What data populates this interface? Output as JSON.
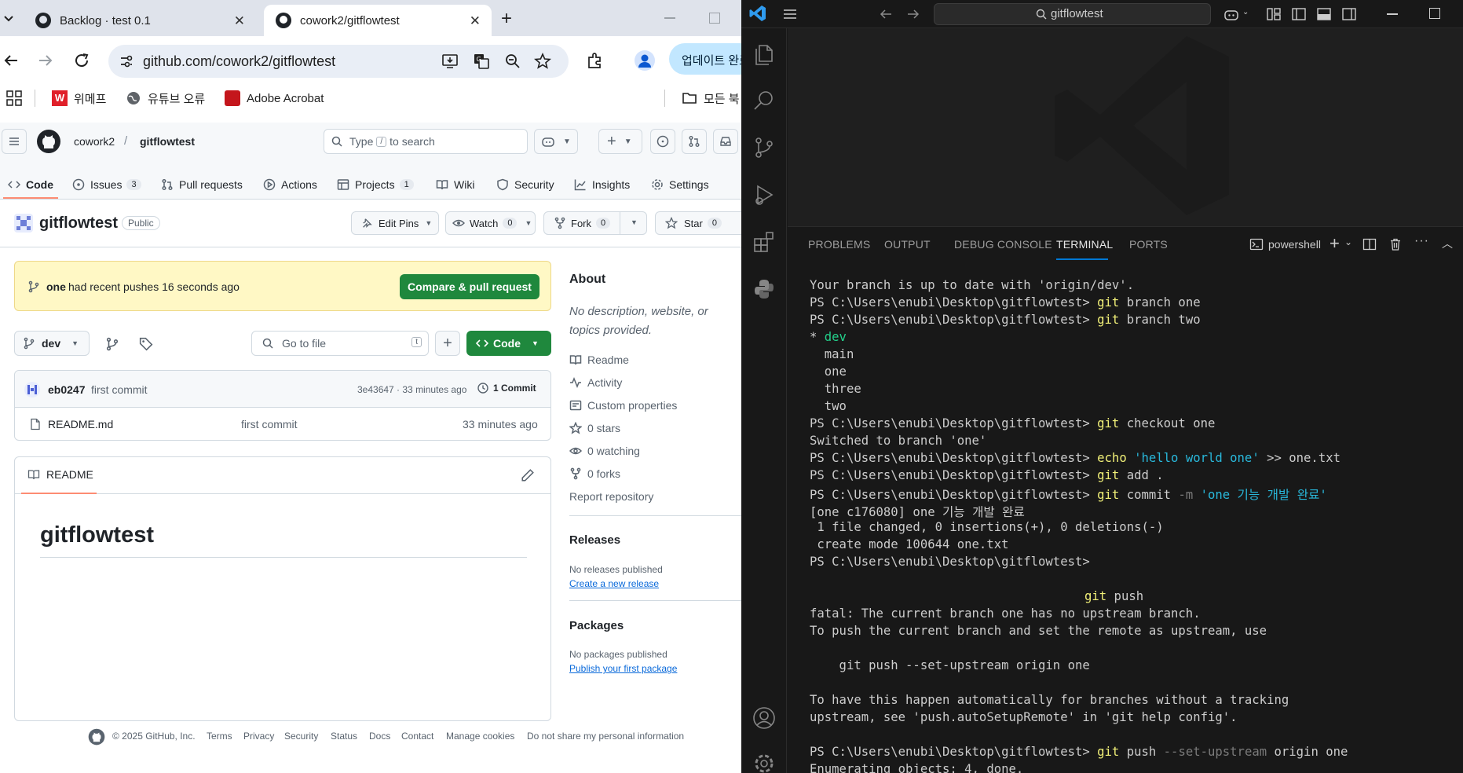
{
  "browser": {
    "tabs": [
      {
        "title": "Backlog · test 0.1",
        "active": false
      },
      {
        "title": "cowork2/gitflowtest",
        "active": true
      }
    ],
    "url": "github.com/cowork2/gitflowtest",
    "update_button": "업데이트 완료",
    "bookmarks": [
      "위메프",
      "유튜브 오류",
      "Adobe Acrobat"
    ],
    "bookmarks_all": "모든 북"
  },
  "github": {
    "owner": "cowork2",
    "separator": "/",
    "repo": "gitflowtest",
    "search_placeholder_pre": "Type",
    "search_key": "/",
    "search_placeholder_post": "to search",
    "nav": [
      {
        "label": "Code",
        "count": ""
      },
      {
        "label": "Issues",
        "count": "3"
      },
      {
        "label": "Pull requests",
        "count": ""
      },
      {
        "label": "Actions",
        "count": ""
      },
      {
        "label": "Projects",
        "count": "1"
      },
      {
        "label": "Wiki",
        "count": ""
      },
      {
        "label": "Security",
        "count": ""
      },
      {
        "label": "Insights",
        "count": ""
      },
      {
        "label": "Settings",
        "count": ""
      }
    ],
    "visibility": "Public",
    "edit_pins": "Edit Pins",
    "watch": "Watch",
    "watch_count": "0",
    "fork": "Fork",
    "fork_count": "0",
    "star": "Star",
    "star_count": "0",
    "push_banner": {
      "branch": "one",
      "text": "had recent pushes 16 seconds ago",
      "button": "Compare & pull request"
    },
    "branch": "dev",
    "go_to_file": "Go to file",
    "go_to_file_key": "t",
    "code_button": "Code",
    "commit": {
      "author": "eb0247",
      "message": "first commit",
      "hash_time": "3e43647 · 33 minutes ago",
      "count": "1 Commit"
    },
    "files": [
      {
        "name": "README.md",
        "message": "first commit",
        "time": "33 minutes ago"
      }
    ],
    "readme_tab": "README",
    "readme_title": "gitflowtest",
    "about": {
      "title": "About",
      "description": "No description, website, or topics provided.",
      "links": [
        "Readme",
        "Activity",
        "Custom properties",
        "0 stars",
        "0 watching",
        "0 forks"
      ],
      "report": "Report repository"
    },
    "releases": {
      "title": "Releases",
      "none": "No releases published",
      "link": "Create a new release"
    },
    "packages": {
      "title": "Packages",
      "none": "No packages published",
      "link": "Publish your first package"
    },
    "footer": {
      "copyright": "© 2025 GitHub, Inc.",
      "links": [
        "Terms",
        "Privacy",
        "Security",
        "Status",
        "Docs",
        "Contact",
        "Manage cookies",
        "Do not share my personal information"
      ]
    }
  },
  "vscode": {
    "search": "gitflowtest",
    "panel_tabs": [
      "PROBLEMS",
      "OUTPUT",
      "DEBUG CONSOLE",
      "TERMINAL",
      "PORTS"
    ],
    "active_panel": "TERMINAL",
    "shell": "powershell",
    "terminal": {
      "prompt": "PS C:\\Users\\enubi\\Desktop\\gitflowtest>",
      "l1": "Your branch is up to date with 'origin/dev'.",
      "c_branch_one": {
        "cmd": "git",
        "args": " branch one"
      },
      "c_branch_two": {
        "cmd": "git",
        "args": " branch two"
      },
      "branch_list": {
        "star": "*",
        "current": "dev",
        "others": [
          "main",
          "one",
          "three",
          "two"
        ]
      },
      "c_checkout": {
        "cmd": "git",
        "args": " checkout one"
      },
      "switched": "Switched to branch 'one'",
      "c_echo": {
        "cmd": "echo",
        "str": "'hello world one'",
        "rest": " >> one.txt"
      },
      "c_add": {
        "cmd": "git",
        "args": " add ."
      },
      "c_commit": {
        "cmd": "git",
        "args": " commit ",
        "flag": "-m",
        "str": "'one 기능 개발 완료'"
      },
      "commit_out": [
        "[one c176080] one 기능 개발 완료",
        " 1 file changed, 0 insertions(+), 0 deletions(-)",
        " create mode 100644 one.txt"
      ],
      "c_push": {
        "cmd": "git",
        "args": " push"
      },
      "fatal": [
        "fatal: The current branch one has no upstream branch.",
        "To push the current branch and set the remote as upstream, use",
        "",
        "    git push --set-upstream origin one",
        "",
        "To have this happen automatically for branches without a tracking",
        "upstream, see 'push.autoSetupRemote' in 'git help config'."
      ],
      "c_push_up": {
        "cmd": "git",
        "args1": " push ",
        "flag": "--set-upstream",
        "args2": " origin one"
      },
      "last": "Enumerating objects: 4, done."
    }
  },
  "colors": {
    "gh_green": "#1f883d",
    "vs_bg": "#181818",
    "term_yellow": "#f1f078",
    "term_green": "#23d18b",
    "term_cyan": "#29b8db"
  }
}
